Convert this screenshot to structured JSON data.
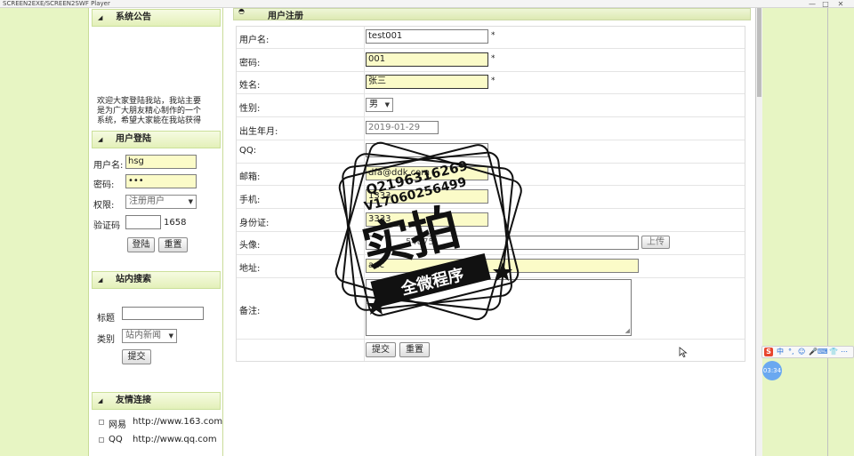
{
  "window": {
    "title": "SCREEN2EXE/SCREEN2SWF Player",
    "minimize": "—",
    "restore": "□",
    "close": "✕"
  },
  "sidebar": {
    "announcement": {
      "title": "系统公告",
      "lines": [
        "欢迎大家登陆我站，我站主要",
        "是为广大朋友精心制作的一个",
        "系统，希望大家能在我站获得"
      ]
    },
    "login": {
      "title": "用户登陆",
      "username_label": "用户名:",
      "username_value": "hsg",
      "password_label": "密码:",
      "password_value": "•••",
      "role_label": "权限:",
      "role_value": "注册用户",
      "captcha_label": "验证码",
      "captcha_code": "1658",
      "login_button": "登陆",
      "reset_button": "重置"
    },
    "search": {
      "title": "站内搜索",
      "keyword_label": "标题",
      "category_label": "类别",
      "category_value": "站内新闻",
      "submit_button": "提交"
    },
    "links": {
      "title": "友情连接",
      "items": [
        {
          "name": "网易",
          "url": "http://www.163.com"
        },
        {
          "name": "QQ",
          "url": "http://www.qq.com"
        }
      ]
    }
  },
  "form": {
    "title": "用户注册",
    "fields": {
      "username": {
        "label": "用户名:",
        "value": "test001",
        "mark": "*"
      },
      "password": {
        "label": "密码:",
        "value": "001",
        "mark": "*"
      },
      "name": {
        "label": "姓名:",
        "value": "张三",
        "mark": "*"
      },
      "gender": {
        "label": "性别:",
        "value": "男"
      },
      "birthday": {
        "label": "出生年月:",
        "value": "2019-01-29"
      },
      "qq": {
        "label": "QQ:",
        "value": ""
      },
      "email": {
        "label": "邮箱:",
        "value": "dfa@ddk.com"
      },
      "phone": {
        "label": "手机:",
        "value": "1333"
      },
      "id_card": {
        "label": "身份证:",
        "value": "3333"
      },
      "avatar": {
        "label": "头像:",
        "value": "54875",
        "upload_button": "上传"
      },
      "address": {
        "label": "地址:",
        "value": "adc"
      },
      "remark": {
        "label": "备注:",
        "value": ""
      }
    },
    "submit_button": "提交",
    "reset_button": "重置"
  },
  "watermark": {
    "contact_qq": "Q2196316269",
    "contact_v": "V17060256499",
    "main_text": "实拍",
    "ribbon_text": "全微程序"
  },
  "ime": {
    "brand": "S",
    "mode": "中",
    "items": [
      "°,",
      "☺",
      "🎤",
      "⌨",
      "👕",
      "⋯"
    ]
  },
  "recorder": {
    "time": "03:34"
  },
  "colors": {
    "sidebar_bg": "#e7f5c3",
    "header_gradient_top": "#f6fbe1",
    "header_gradient_bottom": "#e3f0b9",
    "input_highlight": "#fbfbc8"
  }
}
